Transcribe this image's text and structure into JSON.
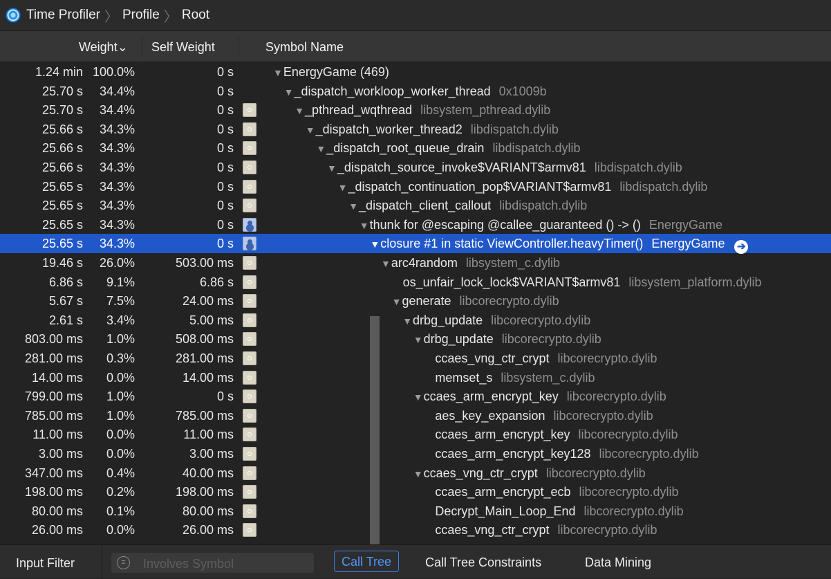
{
  "breadcrumb": [
    "Time Profiler",
    "Profile",
    "Root"
  ],
  "columns": {
    "weight": "Weight",
    "weight_sort": "⌄",
    "self_weight": "Self Weight",
    "symbol": "Symbol Name"
  },
  "rows": [
    {
      "w": "1.24 min",
      "p": "100.0%",
      "s": "0 s",
      "icon": "",
      "depth": 0,
      "tri": "▼",
      "sym": "EnergyGame (469)",
      "lib": ""
    },
    {
      "w": "25.70 s",
      "p": "34.4%",
      "s": "0 s",
      "icon": "",
      "depth": 1,
      "tri": "▼",
      "sym": "_dispatch_workloop_worker_thread",
      "lib": "0x1009b"
    },
    {
      "w": "25.70 s",
      "p": "34.4%",
      "s": "0 s",
      "icon": "gear",
      "depth": 2,
      "tri": "▼",
      "sym": "_pthread_wqthread",
      "lib": "libsystem_pthread.dylib"
    },
    {
      "w": "25.66 s",
      "p": "34.3%",
      "s": "0 s",
      "icon": "gear",
      "depth": 3,
      "tri": "▼",
      "sym": "_dispatch_worker_thread2",
      "lib": "libdispatch.dylib"
    },
    {
      "w": "25.66 s",
      "p": "34.3%",
      "s": "0 s",
      "icon": "gear",
      "depth": 4,
      "tri": "▼",
      "sym": "_dispatch_root_queue_drain",
      "lib": "libdispatch.dylib"
    },
    {
      "w": "25.66 s",
      "p": "34.3%",
      "s": "0 s",
      "icon": "gear",
      "depth": 5,
      "tri": "▼",
      "sym": "_dispatch_source_invoke$VARIANT$armv81",
      "lib": "libdispatch.dylib"
    },
    {
      "w": "25.65 s",
      "p": "34.3%",
      "s": "0 s",
      "icon": "gear",
      "depth": 6,
      "tri": "▼",
      "sym": "_dispatch_continuation_pop$VARIANT$armv81",
      "lib": "libdispatch.dylib"
    },
    {
      "w": "25.65 s",
      "p": "34.3%",
      "s": "0 s",
      "icon": "gear",
      "depth": 7,
      "tri": "▼",
      "sym": "_dispatch_client_callout",
      "lib": "libdispatch.dylib"
    },
    {
      "w": "25.65 s",
      "p": "34.3%",
      "s": "0 s",
      "icon": "user",
      "depth": 8,
      "tri": "▼",
      "sym": "thunk for @escaping @callee_guaranteed () -> ()",
      "lib": "EnergyGame"
    },
    {
      "w": "25.65 s",
      "p": "34.3%",
      "s": "0 s",
      "icon": "user",
      "depth": 9,
      "tri": "▼",
      "sym": "closure #1 in static ViewController.heavyTimer()",
      "lib": "EnergyGame",
      "selected": true
    },
    {
      "w": "19.46 s",
      "p": "26.0%",
      "s": "503.00 ms",
      "icon": "gear",
      "depth": 10,
      "tri": "▼",
      "sym": "arc4random",
      "lib": "libsystem_c.dylib"
    },
    {
      "w": "6.86 s",
      "p": "9.1%",
      "s": "6.86 s",
      "icon": "gear",
      "depth": 11,
      "tri": "",
      "sym": "os_unfair_lock_lock$VARIANT$armv81",
      "lib": "libsystem_platform.dylib"
    },
    {
      "w": "5.67 s",
      "p": "7.5%",
      "s": "24.00 ms",
      "icon": "gear",
      "depth": 11,
      "tri": "▼",
      "sym": "generate",
      "lib": "libcorecrypto.dylib"
    },
    {
      "w": "2.61 s",
      "p": "3.4%",
      "s": "5.00 ms",
      "icon": "gear",
      "depth": 12,
      "tri": "▼",
      "sym": "drbg_update",
      "lib": "libcorecrypto.dylib"
    },
    {
      "w": "803.00 ms",
      "p": "1.0%",
      "s": "508.00 ms",
      "icon": "gear",
      "depth": 13,
      "tri": "▼",
      "sym": "drbg_update",
      "lib": "libcorecrypto.dylib"
    },
    {
      "w": "281.00 ms",
      "p": "0.3%",
      "s": "281.00 ms",
      "icon": "gear",
      "depth": 14,
      "tri": "",
      "sym": "ccaes_vng_ctr_crypt",
      "lib": "libcorecrypto.dylib"
    },
    {
      "w": "14.00 ms",
      "p": "0.0%",
      "s": "14.00 ms",
      "icon": "gear",
      "depth": 14,
      "tri": "",
      "sym": "memset_s",
      "lib": "libsystem_c.dylib"
    },
    {
      "w": "799.00 ms",
      "p": "1.0%",
      "s": "0 s",
      "icon": "gear",
      "depth": 13,
      "tri": "▼",
      "sym": "ccaes_arm_encrypt_key",
      "lib": "libcorecrypto.dylib"
    },
    {
      "w": "785.00 ms",
      "p": "1.0%",
      "s": "785.00 ms",
      "icon": "gear",
      "depth": 14,
      "tri": "",
      "sym": "aes_key_expansion",
      "lib": "libcorecrypto.dylib"
    },
    {
      "w": "11.00 ms",
      "p": "0.0%",
      "s": "11.00 ms",
      "icon": "gear",
      "depth": 14,
      "tri": "",
      "sym": "ccaes_arm_encrypt_key",
      "lib": "libcorecrypto.dylib"
    },
    {
      "w": "3.00 ms",
      "p": "0.0%",
      "s": "3.00 ms",
      "icon": "gear",
      "depth": 14,
      "tri": "",
      "sym": "ccaes_arm_encrypt_key128",
      "lib": "libcorecrypto.dylib"
    },
    {
      "w": "347.00 ms",
      "p": "0.4%",
      "s": "40.00 ms",
      "icon": "gear",
      "depth": 13,
      "tri": "▼",
      "sym": "ccaes_vng_ctr_crypt",
      "lib": "libcorecrypto.dylib"
    },
    {
      "w": "198.00 ms",
      "p": "0.2%",
      "s": "198.00 ms",
      "icon": "gear",
      "depth": 14,
      "tri": "",
      "sym": "ccaes_arm_encrypt_ecb",
      "lib": "libcorecrypto.dylib"
    },
    {
      "w": "80.00 ms",
      "p": "0.1%",
      "s": "80.00 ms",
      "icon": "gear",
      "depth": 14,
      "tri": "",
      "sym": "Decrypt_Main_Loop_End",
      "lib": "libcorecrypto.dylib"
    },
    {
      "w": "26.00 ms",
      "p": "0.0%",
      "s": "26.00 ms",
      "icon": "gear",
      "depth": 14,
      "tri": "",
      "sym": "ccaes_vng_ctr_crypt",
      "lib": "libcorecrypto.dylib"
    }
  ],
  "bottom": {
    "input_filter": "Input Filter",
    "search_placeholder": "Involves Symbol",
    "tabs": [
      "Call Tree",
      "Call Tree Constraints",
      "Data Mining"
    ]
  },
  "colors": {
    "selection": "#2158c9",
    "accent": "#4f96ff"
  }
}
